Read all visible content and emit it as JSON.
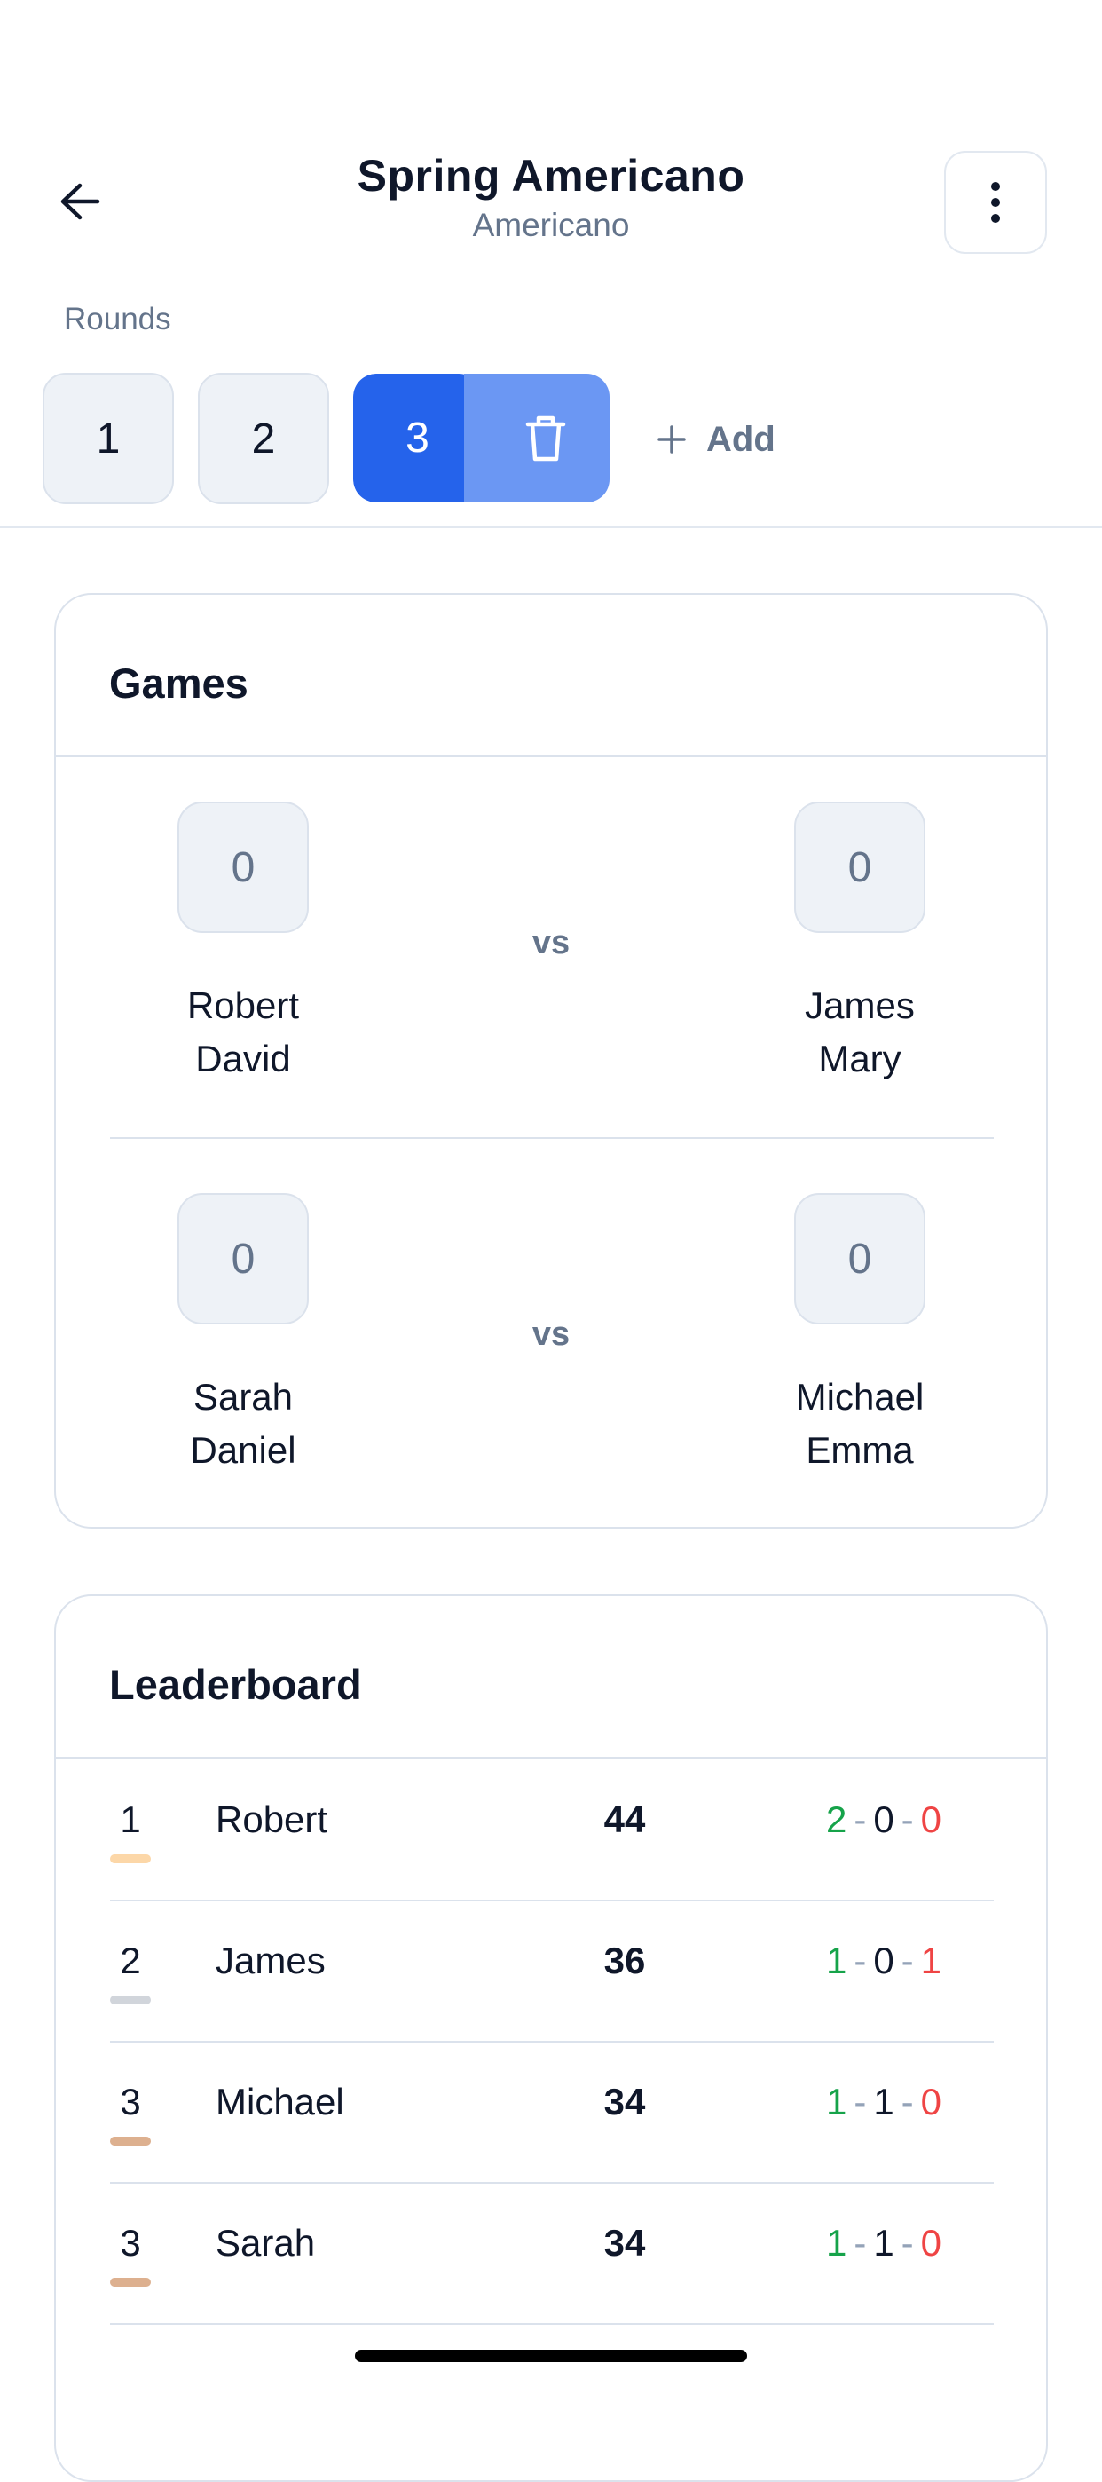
{
  "header": {
    "title": "Spring Americano",
    "subtitle": "Americano"
  },
  "rounds": {
    "label": "Rounds",
    "items": [
      {
        "label": "1"
      },
      {
        "label": "2"
      },
      {
        "label": "3",
        "active": true
      }
    ],
    "add_label": "Add"
  },
  "games": {
    "title": "Games",
    "vs_label": "vs",
    "matches": [
      {
        "left_score": "0",
        "right_score": "0",
        "left_team": [
          "Robert",
          "David"
        ],
        "right_team": [
          "James",
          "Mary"
        ]
      },
      {
        "left_score": "0",
        "right_score": "0",
        "left_team": [
          "Sarah",
          "Daniel"
        ],
        "right_team": [
          "Michael",
          "Emma"
        ]
      }
    ]
  },
  "leaderboard": {
    "title": "Leaderboard",
    "rows": [
      {
        "rank": "1",
        "name": "Robert",
        "points": "44",
        "wins": "2",
        "draws": "0",
        "losses": "0",
        "medal_color": "#fcd7a8"
      },
      {
        "rank": "2",
        "name": "James",
        "points": "36",
        "wins": "1",
        "draws": "0",
        "losses": "1",
        "medal_color": "#d1d5db"
      },
      {
        "rank": "3",
        "name": "Michael",
        "points": "34",
        "wins": "1",
        "draws": "1",
        "losses": "0",
        "medal_color": "#ddb08f"
      },
      {
        "rank": "3",
        "name": "Sarah",
        "points": "34",
        "wins": "1",
        "draws": "1",
        "losses": "0",
        "medal_color": "#ddb08f"
      }
    ]
  },
  "colors": {
    "accent": "#2563eb",
    "delete_bg": "#6b97f3",
    "win": "#16a34a",
    "loss": "#ef4444"
  }
}
